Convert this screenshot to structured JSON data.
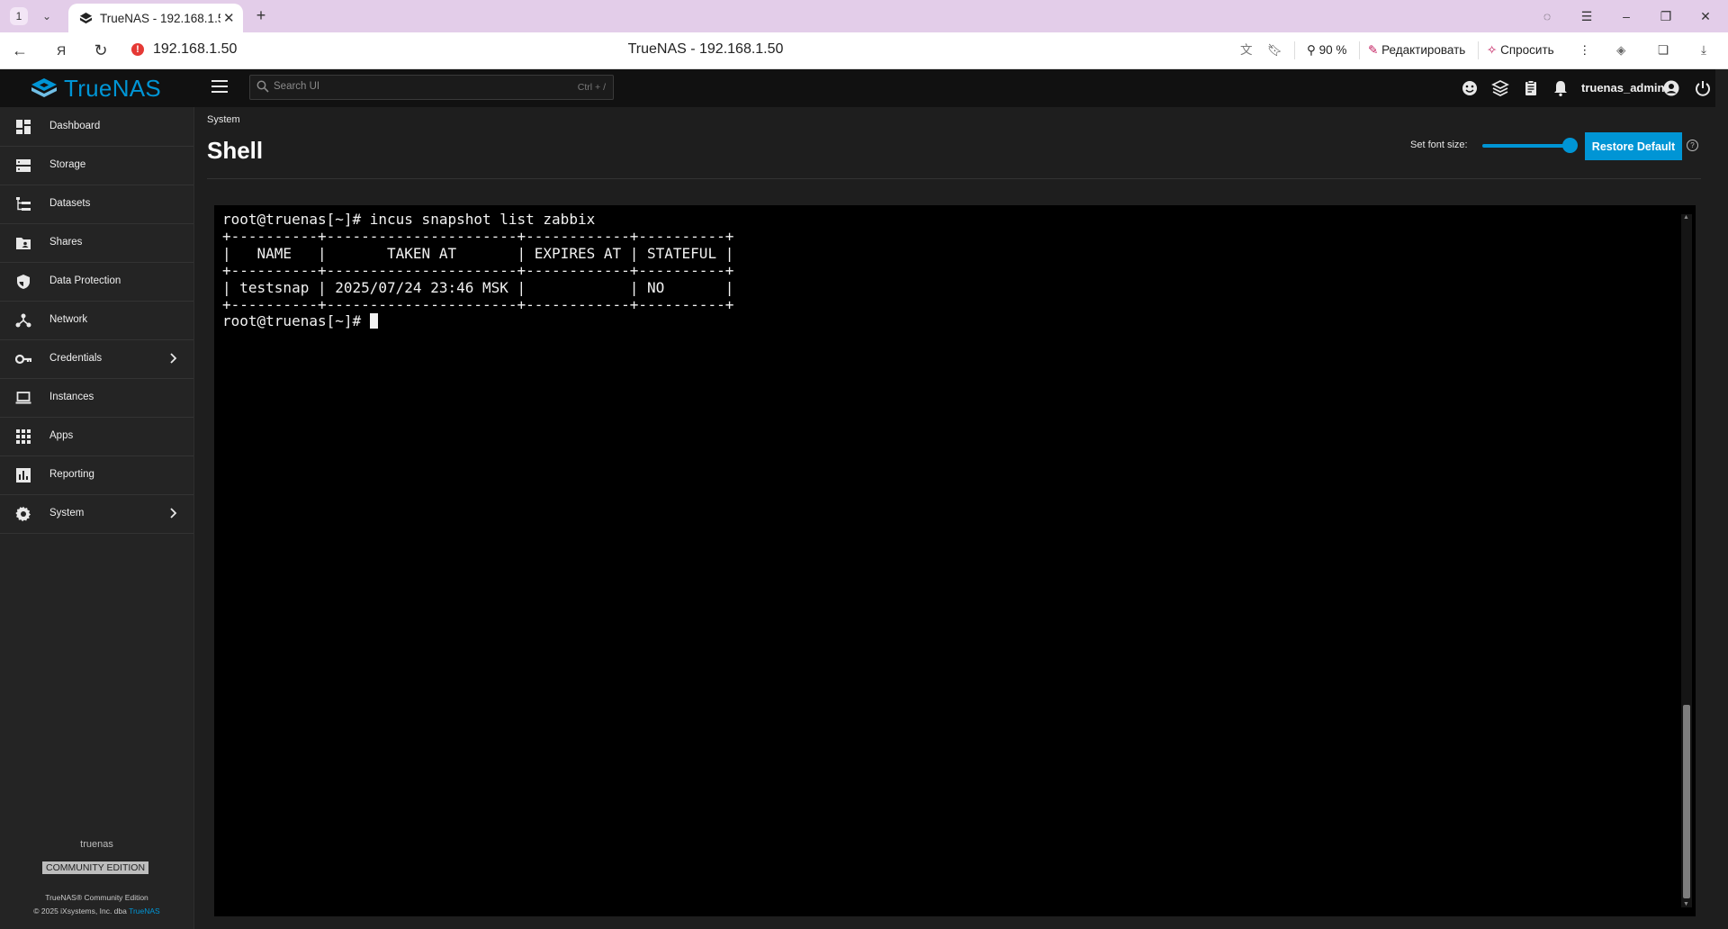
{
  "browser": {
    "tab_count": "1",
    "tab_title": "TrueNAS - 192.168.1.50",
    "url": "192.168.1.50",
    "page_title": "TrueNAS - 192.168.1.50",
    "zoom": "90 %",
    "edit_label": "Редактировать",
    "ask_label": "Спросить"
  },
  "header": {
    "logo_text": "TrueNAS",
    "search_placeholder": "Search UI",
    "search_shortcut": "Ctrl + /",
    "username": "truenas_admin"
  },
  "sidebar": {
    "items": [
      {
        "label": "Dashboard",
        "icon": "dashboard-icon"
      },
      {
        "label": "Storage",
        "icon": "storage-icon"
      },
      {
        "label": "Datasets",
        "icon": "datasets-icon"
      },
      {
        "label": "Shares",
        "icon": "shares-icon"
      },
      {
        "label": "Data Protection",
        "icon": "shield-icon"
      },
      {
        "label": "Network",
        "icon": "network-icon"
      },
      {
        "label": "Credentials",
        "icon": "key-icon"
      },
      {
        "label": "Instances",
        "icon": "laptop-icon"
      },
      {
        "label": "Apps",
        "icon": "apps-grid-icon"
      },
      {
        "label": "Reporting",
        "icon": "chart-icon"
      },
      {
        "label": "System",
        "icon": "gear-icon"
      }
    ],
    "hostname": "truenas",
    "edition": "COMMUNITY EDITION",
    "copyright_line1": "TrueNAS® Community Edition",
    "copyright_line2_prefix": "© 2025 iXsystems, Inc. dba ",
    "copyright_line2_brand": "TrueNAS"
  },
  "main": {
    "breadcrumb": "System",
    "title": "Shell",
    "font_size_label": "Set font size:",
    "font_size_value": 1.0,
    "restore_label": "Restore Default",
    "terminal_lines": [
      "root@truenas[~]# incus snapshot list zabbix",
      "+----------+----------------------+------------+----------+",
      "|   NAME   |       TAKEN AT       | EXPIRES AT | STATEFUL |",
      "+----------+----------------------+------------+----------+",
      "| testsnap | 2025/07/24 23:46 MSK |            | NO       |",
      "+----------+----------------------+------------+----------+"
    ],
    "prompt": "root@truenas[~]# "
  },
  "colors": {
    "accent": "#0095d5",
    "sidebar_bg": "#242424",
    "header_bg": "#111111",
    "terminal_bg": "#000000"
  }
}
